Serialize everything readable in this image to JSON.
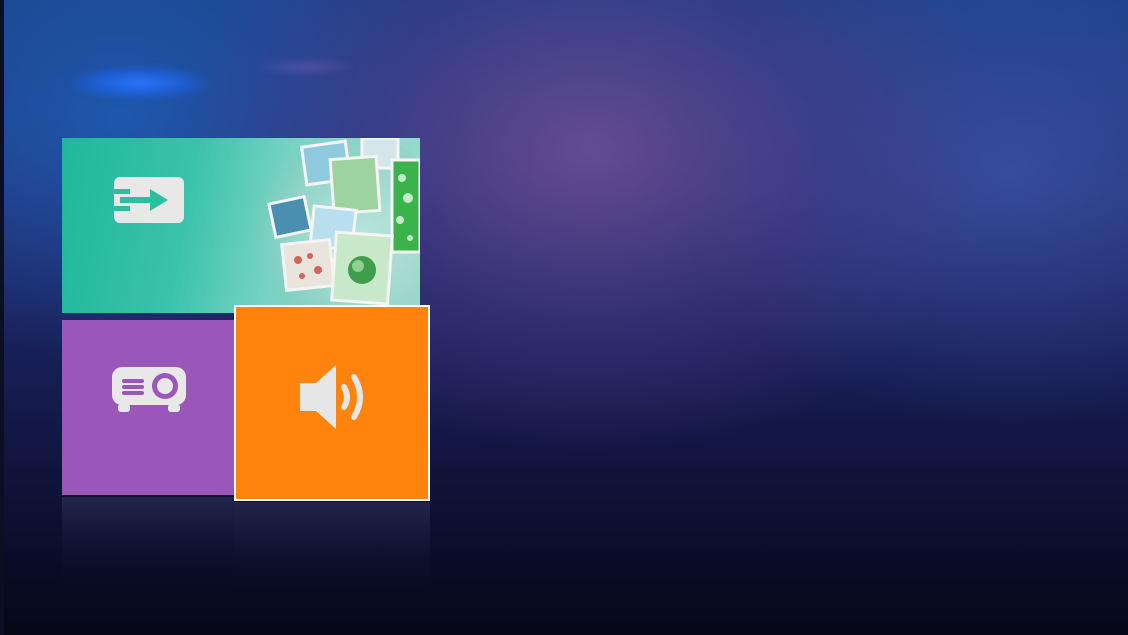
{
  "screen": {
    "name": "home-launcher"
  },
  "tiles": [
    {
      "id": "input",
      "icon": "input-source-icon",
      "color": "#2dbd9f",
      "has_artwork": true
    },
    {
      "id": "projector",
      "icon": "projector-icon",
      "color": "#9b56b9"
    },
    {
      "id": "audio",
      "icon": "speaker-icon",
      "color": "#ff830d",
      "selected": true
    }
  ],
  "colors": {
    "background_top": "#1c3f86",
    "background_bottom": "#060818",
    "tile_teal": "#2dbd9f",
    "tile_purple": "#9b56b9",
    "tile_orange": "#ff830d",
    "focus_border": "#ffffff",
    "icon_fill": "#e6e6e6"
  }
}
